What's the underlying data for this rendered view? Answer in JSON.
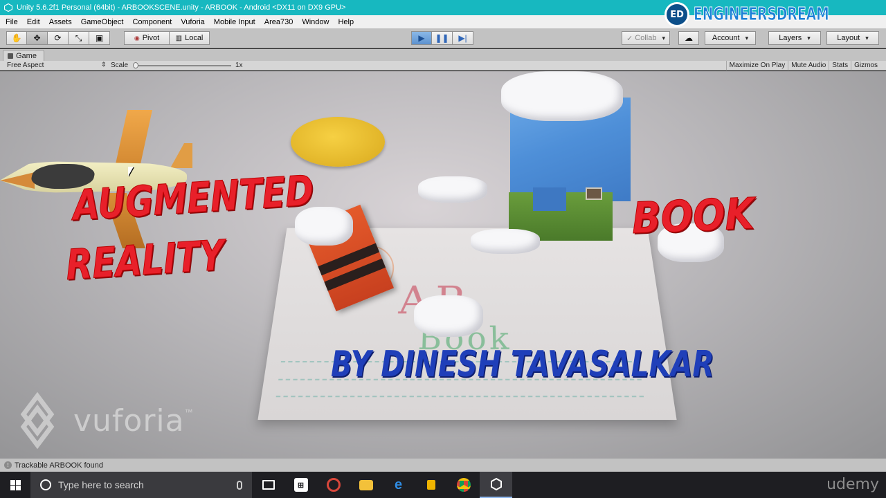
{
  "window": {
    "title": "Unity 5.6.2f1 Personal (64bit) - ARBOOKSCENE.unity - ARBOOK - Android <DX11 on DX9 GPU>"
  },
  "watermark": {
    "brand": "ENGINEERSDREAM",
    "badge": "ED"
  },
  "menubar": {
    "items": [
      "File",
      "Edit",
      "Assets",
      "GameObject",
      "Component",
      "Vuforia",
      "Mobile Input",
      "Area730",
      "Window",
      "Help"
    ]
  },
  "toolbar": {
    "pivot_label": "Pivot",
    "local_label": "Local",
    "collab_label": "Collab",
    "account_label": "Account",
    "layers_label": "Layers",
    "layout_label": "Layout",
    "play_state": "playing",
    "accent_color": "#5d92cf"
  },
  "game_view": {
    "tab_label": "Game",
    "aspect": "Free Aspect",
    "scale_label": "Scale",
    "scale_value": "1x",
    "options": [
      "Maximize On Play",
      "Mute Audio",
      "Stats",
      "Gizmos"
    ]
  },
  "scene": {
    "title_line1": "AUGMENTED",
    "title_line2": "REALITY",
    "book_word": "BOOK",
    "byline": "BY DINESH TAVASALKAR",
    "drawing_ar": "AR",
    "drawing_book": "Book",
    "vuforia_text": "vuforia",
    "vuforia_tm": "™",
    "title_color": "#e8202a",
    "byline_color": "#1f3fb9"
  },
  "statusbar": {
    "message": "Trackable ARBOOK found"
  },
  "taskbar": {
    "search_placeholder": "Type here to search",
    "apps": [
      "task-view-icon",
      "store-icon",
      "app-icon",
      "file-explorer-icon",
      "edge-icon",
      "lock-icon",
      "chrome-icon",
      "unity-icon"
    ],
    "udemy": "udemy"
  }
}
